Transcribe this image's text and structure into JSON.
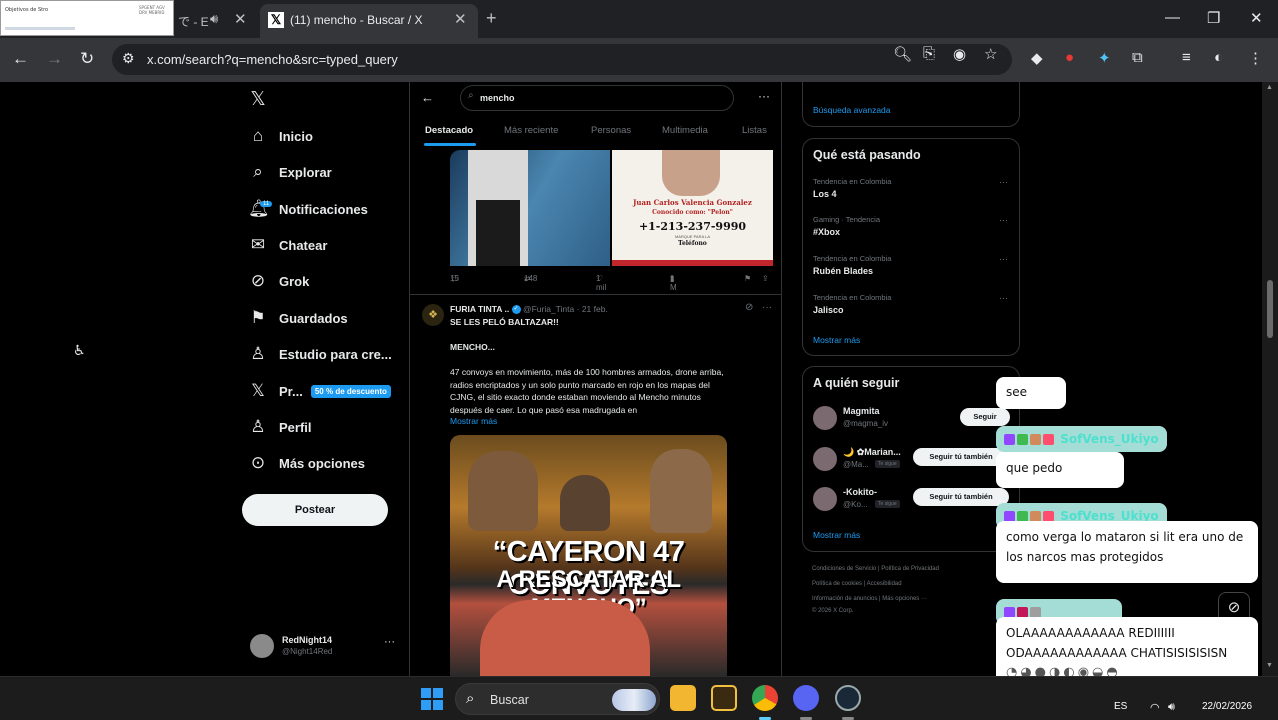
{
  "browser": {
    "thumb_title": "Objetivos de Stro",
    "thumb_side": "SPGENT AGV DRV MEBRID",
    "inactive_tab": "で - E",
    "active_tab_title": "(11) mencho - Buscar / X",
    "url": "x.com/search?q=mencho&src=typed_query"
  },
  "nav": {
    "items": [
      {
        "label": "Inicio",
        "icon": "home-icon"
      },
      {
        "label": "Explorar",
        "icon": "search-icon"
      },
      {
        "label": "Notificaciones",
        "icon": "bell-icon",
        "badge": "11"
      },
      {
        "label": "Chatear",
        "icon": "mail-icon"
      },
      {
        "label": "Grok",
        "icon": "grok-icon"
      },
      {
        "label": "Guardados",
        "icon": "bookmark-icon"
      },
      {
        "label": "Estudio para cre...",
        "icon": "studio-icon"
      },
      {
        "label": "Pr...",
        "icon": "x-premium-icon",
        "promo": "50 % de descuento"
      },
      {
        "label": "Perfil",
        "icon": "person-icon"
      },
      {
        "label": "Más opciones",
        "icon": "more-options-icon"
      }
    ],
    "post_button": "Postear",
    "account": {
      "name": "RedNight14",
      "handle": "@Night14Red"
    }
  },
  "search": {
    "query": "mencho",
    "tabs": [
      "Destacado",
      "Más reciente",
      "Personas",
      "Multimedia",
      "Listas"
    ],
    "active_tab": "Destacado"
  },
  "tweet1": {
    "poster_name": "Juan Carlos Valencia Gonzalez",
    "poster_known": "Conocido como: \"Pelon\"",
    "poster_phone": "+1-213-237-9990",
    "poster_small": "MARQUE PARA LA",
    "poster_tel": "Teléfono",
    "replies": "15",
    "retweets": "148",
    "likes": "1 mil",
    "views": "1 M"
  },
  "tweet2": {
    "name": "FURIA TINTA ..",
    "handle": "@Furia_Tinta",
    "date": "21 feb.",
    "line1": "SE LES PELÓ BALTAZAR!!",
    "line2": "MENCHO...",
    "body": [
      "47 convoys en movimiento, más de 100 hombres armados, drone arriba,",
      "radios encriptados y un solo punto marcado en rojo en los mapas del",
      "CJNG, el sitio exacto donde estaban moviendo al Mencho minutos",
      "después de caer. Lo que pasó esa madrugada en"
    ],
    "show_more": "Mostrar más",
    "image_line1": "“CAYERON 47 CONVOYES",
    "image_line2": "A RESCATAR AL MENCHO”"
  },
  "right": {
    "advanced_search": "Búsqueda avanzada",
    "trends_title": "Qué está pasando",
    "trends": [
      {
        "meta": "Tendencia en Colombia",
        "name": "Los 4"
      },
      {
        "meta": "Gaming · Tendencia",
        "name": "#Xbox"
      },
      {
        "meta": "Tendencia en Colombia",
        "name": "Rubén Blades"
      },
      {
        "meta": "Tendencia en Colombia",
        "name": "Jalisco"
      }
    ],
    "show_more": "Mostrar más",
    "follow_title": "A quién seguir",
    "follows": [
      {
        "name": "Magmita",
        "handle": "@magma_iv",
        "button": "Seguir"
      },
      {
        "name": "🌙 ✿Marian...",
        "handle": "@Ma...",
        "button": "Seguir tú también",
        "tag": "Te sigue"
      },
      {
        "name": "-Kokito-",
        "handle": "@Ko...",
        "button": "Seguir tú también",
        "tag": "Te sigue"
      }
    ],
    "footer": [
      "Condiciones de Servicio  |  Política de Privacidad",
      "Política de cookies  |  Accesibilidad",
      "Información de anuncios  |  Más opciones ···",
      "© 2026 X Corp."
    ]
  },
  "chat": {
    "messages": [
      {
        "user": "",
        "text": "see"
      },
      {
        "user": "SofVens_Ukiyo",
        "text": "que pedo"
      },
      {
        "user": "SofVens_Ukiyo",
        "text": "como verga lo mataron si lit era uno de los narcos mas protegidos"
      },
      {
        "user": "",
        "text": "OLAAAAAAAAAAAA REDIIIIII ODAAAAAAAAAAAA CHATISISISISISN"
      }
    ]
  },
  "taskbar": {
    "search_label": "Buscar",
    "lang": "ES",
    "date": "22/02/2026"
  }
}
